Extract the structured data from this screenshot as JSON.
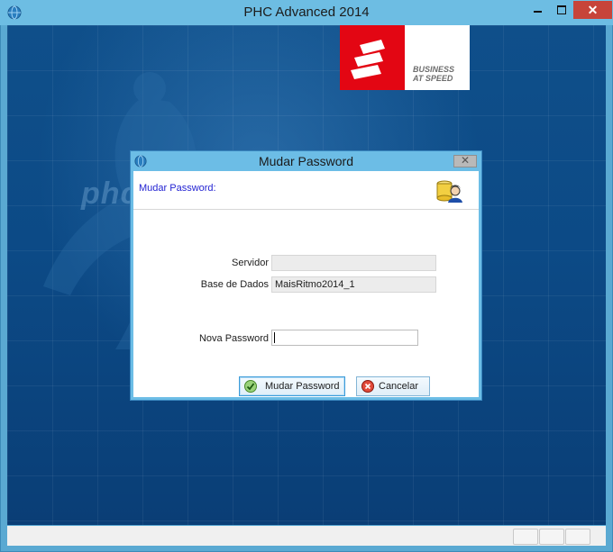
{
  "window": {
    "title": "PHC Advanced 2014",
    "close_glyph": "✕"
  },
  "logo": {
    "tagline_line1": "BUSINESS",
    "tagline_line2": "AT SPEED",
    "brand_word": "phc"
  },
  "dialog": {
    "title": "Mudar Password",
    "close_glyph": "✕",
    "header_label": "Mudar Password:",
    "fields": {
      "servidor_label": "Servidor",
      "servidor_value": "",
      "base_label": "Base de Dados",
      "base_value": "MaisRitmo2014_1",
      "password_label": "Nova Password",
      "password_value": ""
    },
    "buttons": {
      "confirm_label": "Mudar Password",
      "cancel_label": "Cancelar"
    }
  },
  "colors": {
    "titlebar": "#6dbde3",
    "close": "#c7443a",
    "accent_red": "#e30613",
    "header_text": "#2323d2"
  }
}
